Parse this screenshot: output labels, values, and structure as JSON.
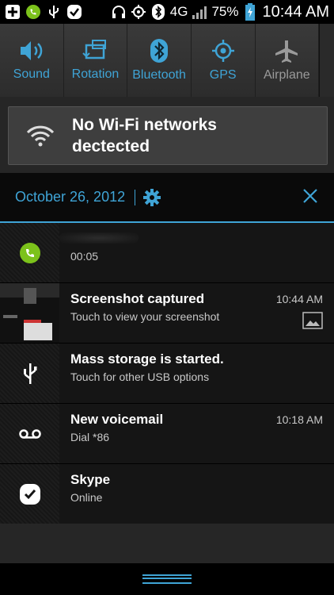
{
  "status_bar": {
    "network": "4G",
    "battery": "75%",
    "time": "10:44 AM",
    "icons": [
      "add-icon",
      "phone-icon",
      "usb-icon",
      "check-icon",
      "headset-icon",
      "gps-icon",
      "bluetooth-icon",
      "signal-icon",
      "battery-icon"
    ]
  },
  "quick_settings": [
    {
      "label": "Sound",
      "icon": "sound-icon",
      "active": true
    },
    {
      "label": "Rotation",
      "icon": "rotation-icon",
      "active": true
    },
    {
      "label": "Bluetooth",
      "icon": "bluetooth-icon",
      "active": true
    },
    {
      "label": "GPS",
      "icon": "gps-icon",
      "active": true
    },
    {
      "label": "Airplane",
      "icon": "airplane-icon",
      "active": false
    }
  ],
  "wifi": {
    "line1": "No Wi-Fi networks",
    "line2": "dectected"
  },
  "header": {
    "date": "October 26, 2012"
  },
  "notifications": [
    {
      "title": "",
      "sub": "00:05",
      "time": "",
      "icon": "phone-icon"
    },
    {
      "title": "Screenshot captured",
      "sub": "Touch to view your screenshot",
      "time": "10:44 AM",
      "icon": "screenshot-thumbnail"
    },
    {
      "title": "Mass storage is started.",
      "sub": "Touch for other USB options",
      "time": "",
      "icon": "usb-icon"
    },
    {
      "title": "New voicemail",
      "sub": "Dial *86",
      "time": "10:18 AM",
      "icon": "voicemail-icon"
    },
    {
      "title": "Skype",
      "sub": "Online",
      "time": "",
      "icon": "skype-icon"
    }
  ],
  "colors": {
    "accent": "#3fa4d6",
    "call_green": "#7cc21b"
  }
}
